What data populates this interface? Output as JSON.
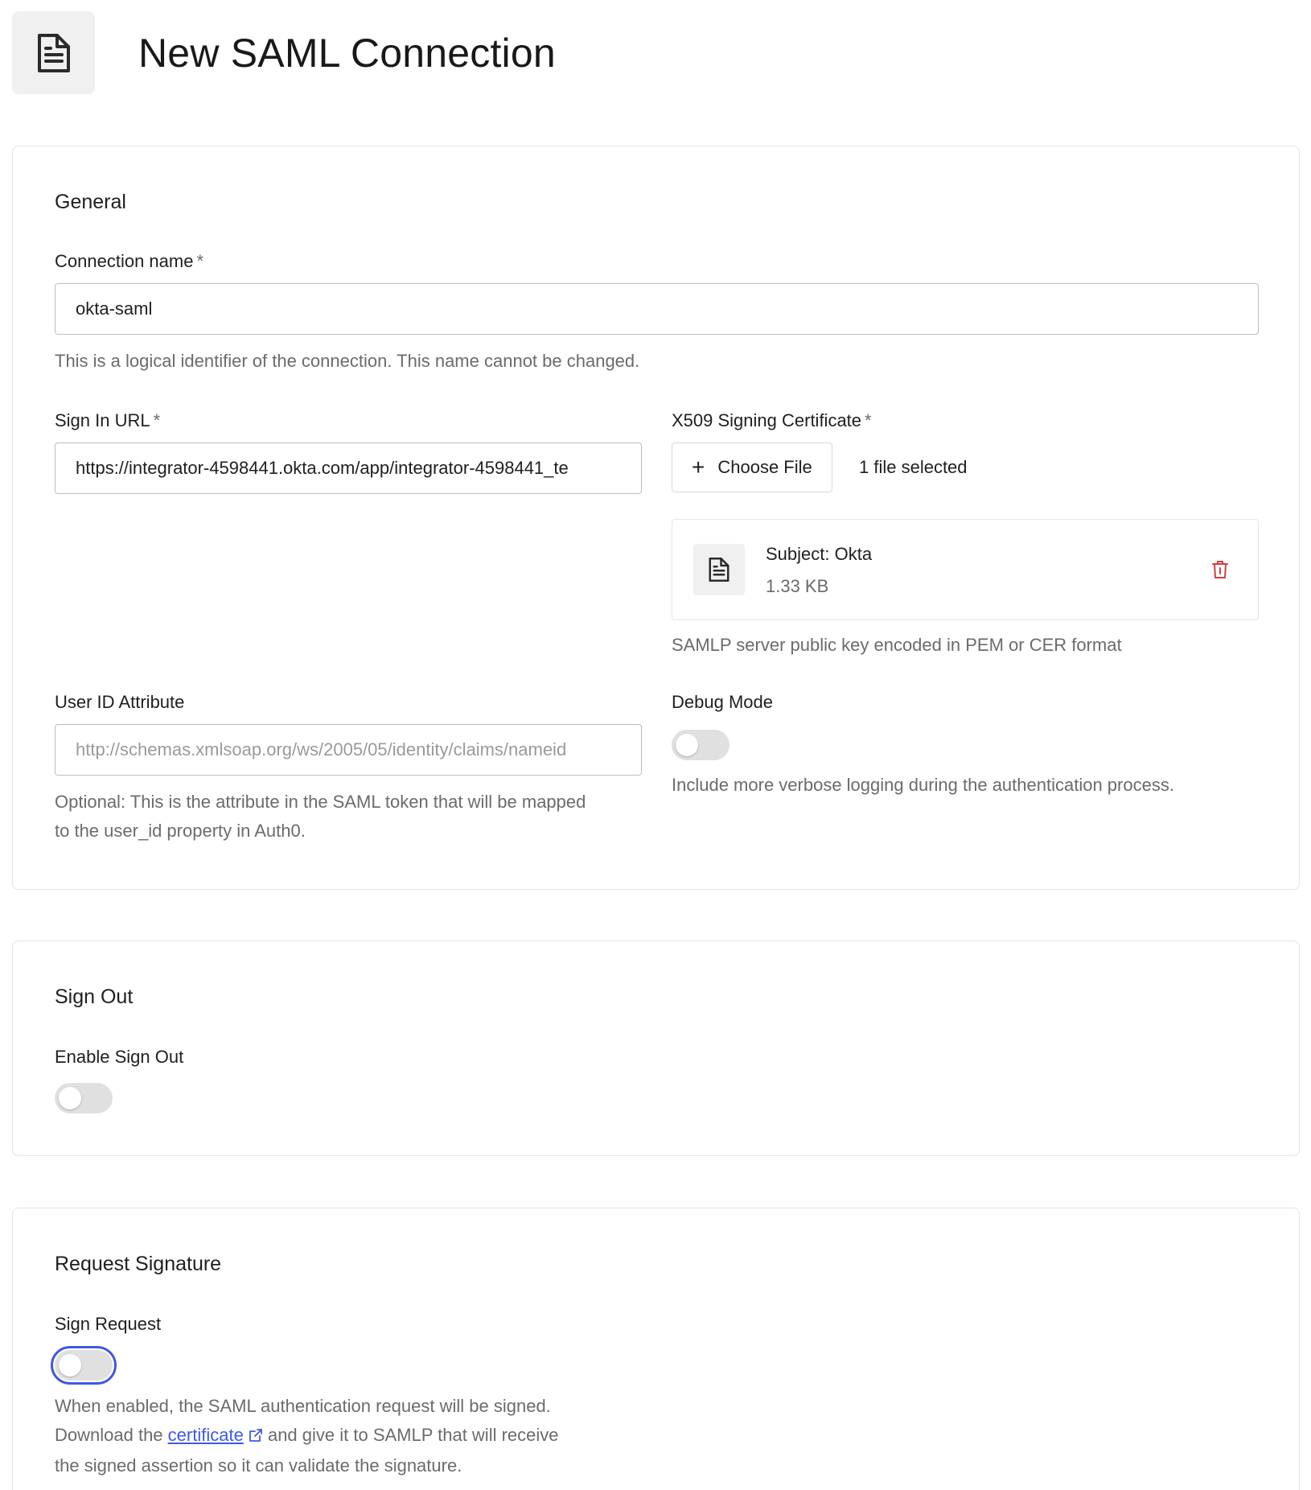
{
  "header": {
    "title": "New SAML Connection",
    "icon": "document-icon"
  },
  "general": {
    "section_title": "General",
    "connection_name": {
      "label": "Connection name",
      "required_mark": "*",
      "value": "okta-saml",
      "help": "This is a logical identifier of the connection. This name cannot be changed."
    },
    "sign_in_url": {
      "label": "Sign In URL",
      "required_mark": "*",
      "value": "https://integrator-4598441.okta.com/app/integrator-4598441_te"
    },
    "x509": {
      "label": "X509 Signing Certificate",
      "required_mark": "*",
      "choose_label": "Choose File",
      "choose_icon": "+",
      "file_status": "1 file selected",
      "file": {
        "name": "Subject: Okta",
        "size": "1.33 KB"
      },
      "help": "SAMLP server public key encoded in PEM or CER format"
    },
    "user_id_attribute": {
      "label": "User ID Attribute",
      "placeholder": "http://schemas.xmlsoap.org/ws/2005/05/identity/claims/nameid",
      "help_line1": "Optional: This is the attribute in the SAML token that will be mapped",
      "help_line2": "to the user_id property in Auth0."
    },
    "debug_mode": {
      "label": "Debug Mode",
      "enabled": false,
      "help": "Include more verbose logging during the authentication process."
    }
  },
  "sign_out": {
    "section_title": "Sign Out",
    "enable_label": "Enable Sign Out",
    "enabled": false
  },
  "request_signature": {
    "section_title": "Request Signature",
    "sign_request_label": "Sign Request",
    "enabled": false,
    "help_line1": "When enabled, the SAML authentication request will be signed.",
    "help_line2_before": "Download the",
    "help_link": "certificate",
    "help_line2_after": "and give it to SAMLP that will receive",
    "help_line3": "the signed assertion so it can validate the signature."
  },
  "colors": {
    "accent": "#3f59e4",
    "danger": "#d93c3c",
    "muted_text": "#6b6b6b"
  }
}
